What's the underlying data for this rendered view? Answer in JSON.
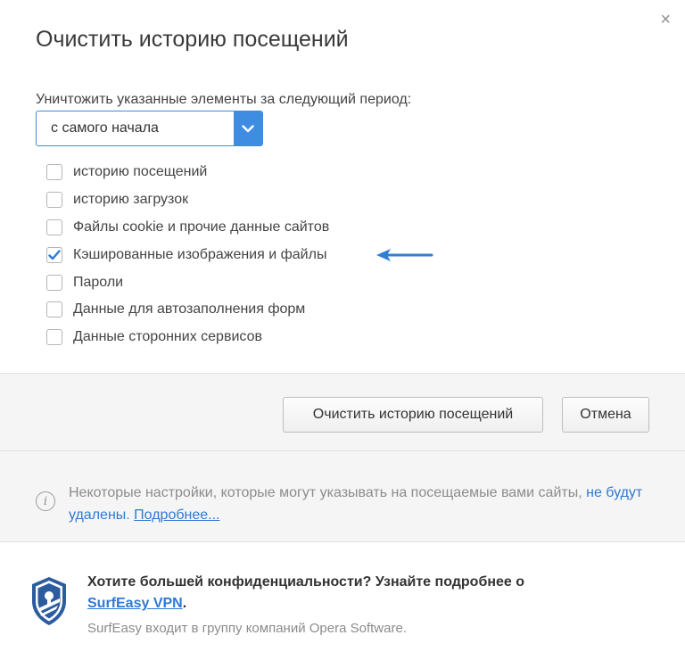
{
  "dialog": {
    "title": "Очистить историю посещений",
    "close_glyph": "×"
  },
  "period": {
    "label": "Уничтожить указанные элементы за следующий период:",
    "selected": "с самого начала"
  },
  "checkboxes": [
    {
      "label": "историю посещений",
      "checked": false
    },
    {
      "label": "историю загрузок",
      "checked": false
    },
    {
      "label": "Файлы cookie и прочие данные сайтов",
      "checked": false
    },
    {
      "label": "Кэшированные изображения и файлы",
      "checked": true
    },
    {
      "label": "Пароли",
      "checked": false
    },
    {
      "label": "Данные для автозаполнения форм",
      "checked": false
    },
    {
      "label": "Данные сторонних сервисов",
      "checked": false
    }
  ],
  "buttons": {
    "clear": "Очистить историю посещений",
    "cancel": "Отмена"
  },
  "info": {
    "text_before": "Некоторые настройки, которые могут указывать на посещаемые вами сайты, ",
    "link_plain": "не будут удалены",
    "text_mid": ". ",
    "link_more": "Подробнее..."
  },
  "promo": {
    "line1": "Хотите большей конфиденциальности? Узнайте подробнее о",
    "link": "SurfEasy VPN",
    "link_suffix": ".",
    "line3": "SurfEasy входит в группу компаний Opera Software."
  },
  "colors": {
    "accent": "#3f8de3",
    "check": "#2f79d3",
    "pointer_arrow": "#2f7fd6",
    "shield": "#2b5c9e"
  },
  "icons": {
    "close": "close-icon",
    "dropdown": "chevron-down-icon",
    "info": "info-icon",
    "check": "checkmark-icon",
    "shield": "shield-lock-icon",
    "pointer": "arrow-left-icon"
  }
}
